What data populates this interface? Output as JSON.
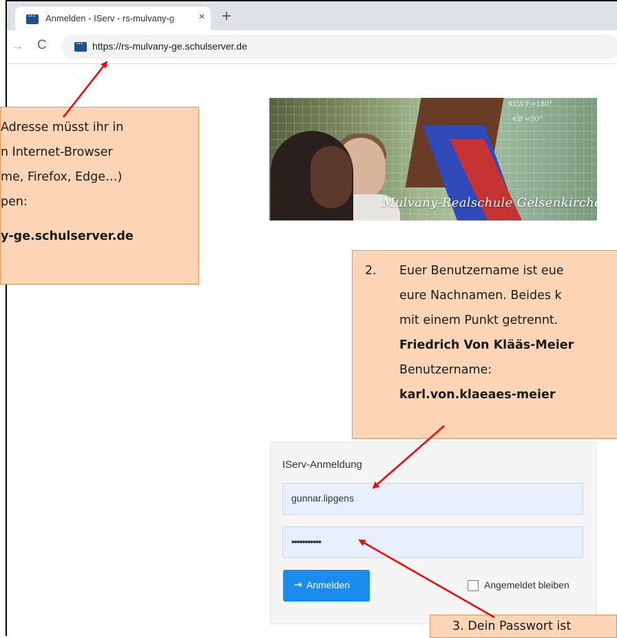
{
  "browser": {
    "tab_title": "Anmelden - IServ - rs-mulvany-g",
    "tab_close": "×",
    "new_tab": "+",
    "nav_forward": "→",
    "nav_reload": "C",
    "url": "https://rs-mulvany-ge.schulserver.de"
  },
  "banner": {
    "caption": "Mulvany-Realschule Gelsenkirchen",
    "math1": "∢CA'F=180°",
    "math2": "∢B'=90°"
  },
  "callout1": {
    "lines": [
      "Adresse müsst ihr in",
      "n Internet-Browser",
      "me, Firefox, Edge…)",
      "pen:",
      "y-ge.schulserver.de"
    ]
  },
  "callout2": {
    "number": "2.",
    "lines": [
      "Euer Benutzername ist eue",
      "eure Nachnamen. Beides k",
      "mit einem Punkt getrennt.",
      "Friedrich Von Klääs-Meier",
      "Benutzername:",
      "karl.von.klaeaes-meier"
    ]
  },
  "callout3": {
    "text": "3.    Dein Passwort ist"
  },
  "login": {
    "title": "IServ-Anmeldung",
    "username": "gunnar.lipgens",
    "password": "•••••••••••",
    "submit_icon": "⇥",
    "submit_label": "Anmelden",
    "remember_label": "Angemeldet bleiben"
  },
  "colors": {
    "callout_bg": "#fbd5b5",
    "callout_border": "#e0955a",
    "button": "#1a8cf0",
    "arrow": "#ff0000"
  }
}
